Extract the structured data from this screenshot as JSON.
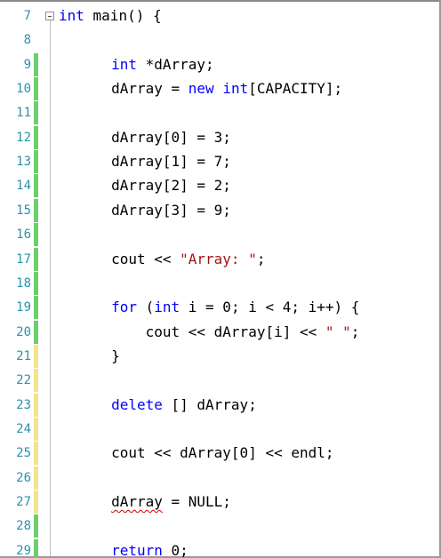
{
  "editor": {
    "collapse_symbol": "minus",
    "lines": [
      {
        "number": "7",
        "gutter": "none",
        "indent": "",
        "tokens": [
          {
            "t": "kw",
            "v": "int"
          },
          {
            "t": "plain",
            "v": " main() {"
          }
        ]
      },
      {
        "number": "8",
        "gutter": "none",
        "indent": "",
        "tokens": []
      },
      {
        "number": "9",
        "gutter": "saved",
        "indent": "        ",
        "tokens": [
          {
            "t": "kw",
            "v": "int"
          },
          {
            "t": "plain",
            "v": " *dArray;"
          }
        ]
      },
      {
        "number": "10",
        "gutter": "saved",
        "indent": "        ",
        "tokens": [
          {
            "t": "plain",
            "v": "dArray = "
          },
          {
            "t": "kw",
            "v": "new"
          },
          {
            "t": "plain",
            "v": " "
          },
          {
            "t": "kw",
            "v": "int"
          },
          {
            "t": "plain",
            "v": "[CAPACITY];"
          }
        ]
      },
      {
        "number": "11",
        "gutter": "saved",
        "indent": "",
        "tokens": []
      },
      {
        "number": "12",
        "gutter": "saved",
        "indent": "        ",
        "tokens": [
          {
            "t": "plain",
            "v": "dArray[0] = 3;"
          }
        ]
      },
      {
        "number": "13",
        "gutter": "saved",
        "indent": "        ",
        "tokens": [
          {
            "t": "plain",
            "v": "dArray[1] = 7;"
          }
        ]
      },
      {
        "number": "14",
        "gutter": "saved",
        "indent": "        ",
        "tokens": [
          {
            "t": "plain",
            "v": "dArray[2] = 2;"
          }
        ]
      },
      {
        "number": "15",
        "gutter": "saved",
        "indent": "        ",
        "tokens": [
          {
            "t": "plain",
            "v": "dArray[3] = 9;"
          }
        ]
      },
      {
        "number": "16",
        "gutter": "saved",
        "indent": "",
        "tokens": []
      },
      {
        "number": "17",
        "gutter": "saved",
        "indent": "        ",
        "tokens": [
          {
            "t": "plain",
            "v": "cout << "
          },
          {
            "t": "str",
            "v": "\"Array: \""
          },
          {
            "t": "plain",
            "v": ";"
          }
        ]
      },
      {
        "number": "18",
        "gutter": "saved",
        "indent": "",
        "tokens": []
      },
      {
        "number": "19",
        "gutter": "saved",
        "indent": "        ",
        "tokens": [
          {
            "t": "kw",
            "v": "for"
          },
          {
            "t": "plain",
            "v": " ("
          },
          {
            "t": "kw",
            "v": "int"
          },
          {
            "t": "plain",
            "v": " i = 0; i < 4; i++) {"
          }
        ]
      },
      {
        "number": "20",
        "gutter": "saved",
        "indent": "            ",
        "tokens": [
          {
            "t": "plain",
            "v": "cout << dArray[i] << "
          },
          {
            "t": "str",
            "v": "\" \""
          },
          {
            "t": "plain",
            "v": ";"
          }
        ]
      },
      {
        "number": "21",
        "gutter": "unsaved",
        "indent": "        ",
        "tokens": [
          {
            "t": "plain",
            "v": "}"
          }
        ]
      },
      {
        "number": "22",
        "gutter": "unsaved",
        "indent": "",
        "tokens": []
      },
      {
        "number": "23",
        "gutter": "unsaved",
        "indent": "        ",
        "tokens": [
          {
            "t": "kw",
            "v": "delete"
          },
          {
            "t": "plain",
            "v": " [] dArray;"
          }
        ]
      },
      {
        "number": "24",
        "gutter": "unsaved",
        "indent": "",
        "tokens": []
      },
      {
        "number": "25",
        "gutter": "unsaved",
        "indent": "        ",
        "tokens": [
          {
            "t": "plain",
            "v": "cout << dArray[0] << endl;"
          }
        ]
      },
      {
        "number": "26",
        "gutter": "unsaved",
        "indent": "",
        "tokens": []
      },
      {
        "number": "27",
        "gutter": "unsaved",
        "indent": "        ",
        "tokens": [
          {
            "t": "squiggle",
            "v": "dArray"
          },
          {
            "t": "plain",
            "v": " = NULL;"
          }
        ]
      },
      {
        "number": "28",
        "gutter": "saved",
        "indent": "",
        "tokens": []
      },
      {
        "number": "29",
        "gutter": "saved",
        "indent": "        ",
        "tokens": [
          {
            "t": "kw",
            "v": "return"
          },
          {
            "t": "plain",
            "v": " 0;"
          }
        ]
      }
    ]
  },
  "colors": {
    "keyword": "#0000ff",
    "string": "#a31515",
    "line_number": "#2b91af",
    "gutter_saved": "#6ccf6c",
    "gutter_unsaved": "#f2e58c",
    "squiggle": "#d00000"
  }
}
